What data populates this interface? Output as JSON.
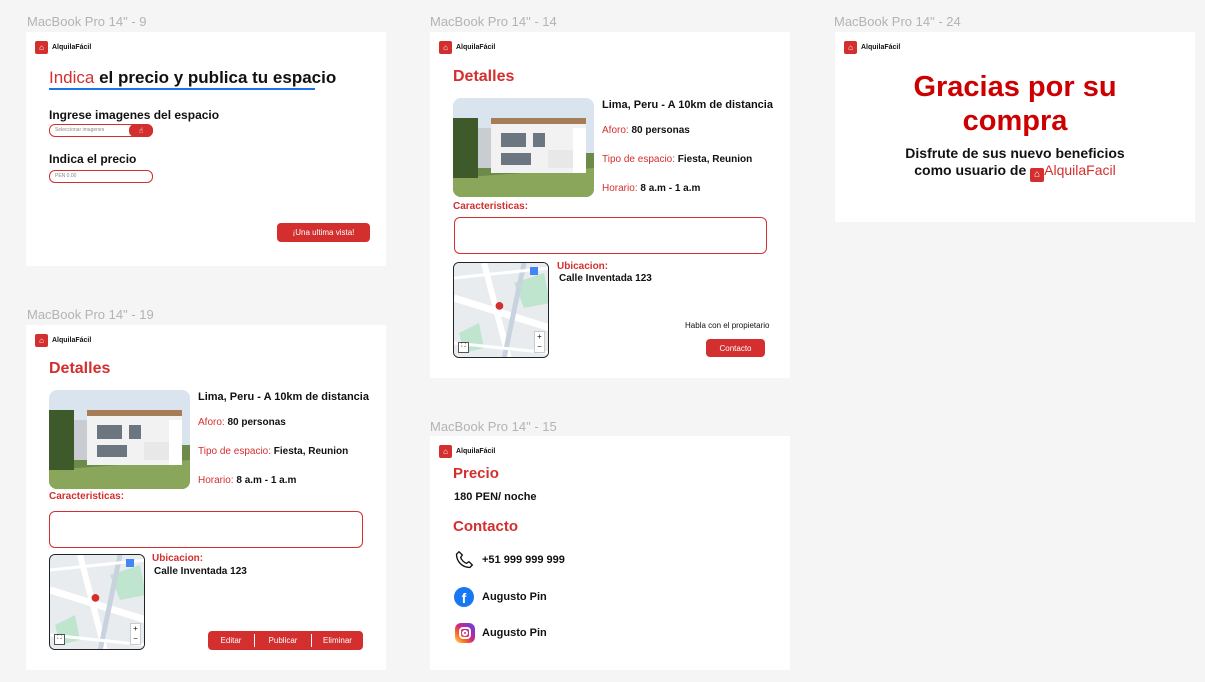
{
  "frames": {
    "f9": {
      "label": "MacBook Pro 14\" - 9"
    },
    "f14": {
      "label": "MacBook Pro 14\" - 14"
    },
    "f24": {
      "label": "MacBook Pro 14\" - 24"
    },
    "f19": {
      "label": "MacBook Pro 14\" - 19"
    },
    "f15": {
      "label": "MacBook Pro 14\" - 15"
    }
  },
  "brand": {
    "name": "AlquilaFácil"
  },
  "publish": {
    "heading_accent": "Indica",
    "heading_rest": " el precio y publica tu espacio",
    "images_label": "Ingrese imagenes del espacio",
    "images_placeholder": "Seleccionar imagenes",
    "price_label": "Indica el precio",
    "price_placeholder": "PEN 0.00",
    "preview_button": "¡Una ultima vista!"
  },
  "details": {
    "title": "Detalles",
    "location": "Lima, Peru - A 10km de distancia",
    "capacity_label": "Aforo:",
    "capacity_value": " 80 personas",
    "type_label": "Tipo de espacio:",
    "type_value": " Fiesta, Reunion",
    "schedule_label": "Horario:",
    "schedule_value": " 8 a.m - 1 a.m",
    "features_label": "Caracteristicas:",
    "location_label": "Ubicacion:",
    "address": "Calle Inventada 123",
    "owner_text": "Habla con el propietario",
    "contact_button": "Contacto",
    "edit_button": "Editar",
    "publish_button": "Publicar",
    "delete_button": "Eliminar"
  },
  "thanks": {
    "title_line1": "Gracias por su",
    "title_line2": "compra",
    "subtitle_line1": "Disfrute de sus nuevo beneficios",
    "subtitle_line2": "como usuario de ",
    "brand": "AlquilaFacil"
  },
  "contact": {
    "price_title": "Precio",
    "price_value": "180 PEN/ noche",
    "contact_title": "Contacto",
    "phone": "+51 999 999 999",
    "facebook": "Augusto Pin",
    "instagram": "Augusto Pin"
  },
  "colors": {
    "accent": "#d32f2f",
    "underline": "#1a73e8"
  }
}
